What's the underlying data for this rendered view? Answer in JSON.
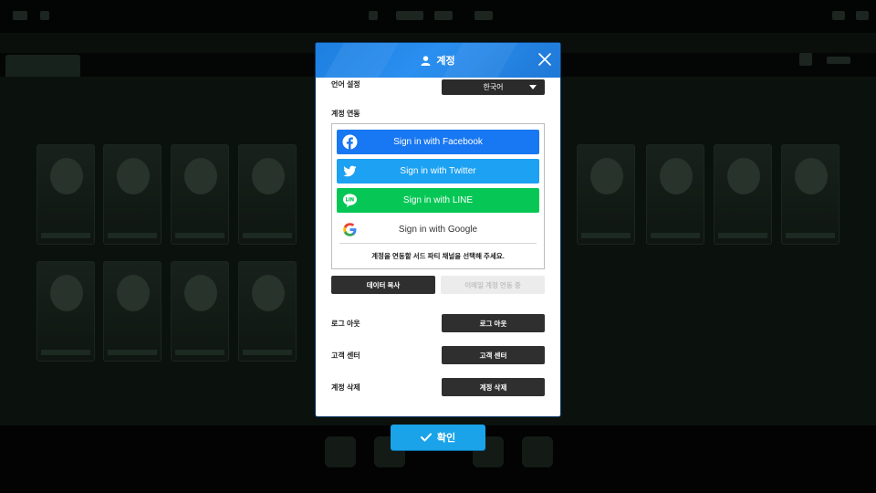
{
  "modal": {
    "title": "계정",
    "language": {
      "label": "언어 설정",
      "selected": "한국어"
    },
    "account_link": {
      "label": "계정 연동",
      "facebook": "Sign in with Facebook",
      "twitter": "Sign in with Twitter",
      "line": "Sign in with LINE",
      "google": "Sign in with Google",
      "note": "계정을 연동할 서드 파티 채널을 선택해 주세요."
    },
    "data_copy_button": "데이터 복사",
    "mobile_link_button": "이메일 계정 연동 중",
    "rows": [
      {
        "label": "로그 아웃",
        "button": "로그 아웃"
      },
      {
        "label": "고객 센터",
        "button": "고객 센터"
      },
      {
        "label": "계정 삭제",
        "button": "계정 삭제"
      }
    ]
  },
  "confirm_button": "확인",
  "colors": {
    "header": "#1d7fe0",
    "facebook": "#1877f2",
    "twitter": "#1da1f2",
    "line": "#06c755",
    "confirm": "#1aa3e8"
  },
  "icons": [
    "user-icon",
    "close-icon",
    "dropdown-caret-icon",
    "facebook-icon",
    "twitter-icon",
    "line-icon",
    "google-icon",
    "check-icon"
  ]
}
